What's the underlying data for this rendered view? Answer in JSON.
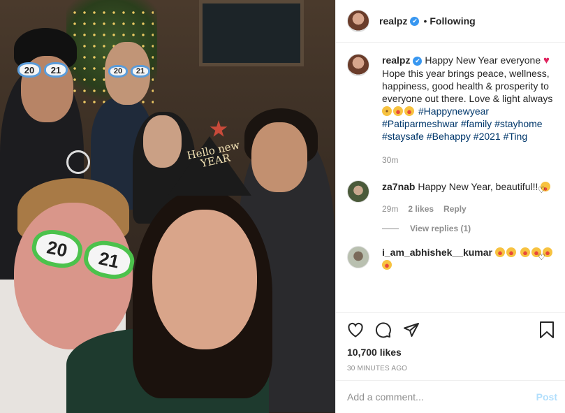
{
  "header": {
    "username": "realpz",
    "verified": "✔",
    "separator": "•",
    "follow_status": "Following"
  },
  "caption": {
    "username": "realpz",
    "text_line1": "Happy New Year everyone",
    "text_rest": "Hope this year brings peace, wellness, happiness, good health & prosperity to everyone out there. Love & light always",
    "hashtags": [
      "#Happynewyear",
      "#Patiparmeshwar",
      "#family",
      "#stayhome",
      "#staysafe",
      "#Behappy",
      "#2021",
      "#Ting"
    ],
    "time": "30m"
  },
  "comments": [
    {
      "username": "za7nab",
      "text": "Happy New Year, beautiful!!",
      "time": "29m",
      "likes": "2 likes",
      "reply": "Reply",
      "view_replies": "View replies (1)"
    },
    {
      "username": "i_am_abhishek__kumar"
    }
  ],
  "photo": {
    "glasses_digits_left": "20",
    "glasses_digits_right": "21",
    "hat_text": "Hello new YEAR"
  },
  "stats": {
    "likes": "10,700 likes",
    "posted": "30 MINUTES AGO"
  },
  "add_comment": {
    "placeholder": "Add a comment...",
    "post_label": "Post"
  },
  "icons": {
    "like": "heart-icon",
    "comment": "comment-icon",
    "share": "paper-plane-icon",
    "save": "bookmark-icon"
  },
  "colors": {
    "link": "#00376b",
    "verified": "#3897f0",
    "post_button": "#b2dffc",
    "heart": "#e0245e"
  }
}
